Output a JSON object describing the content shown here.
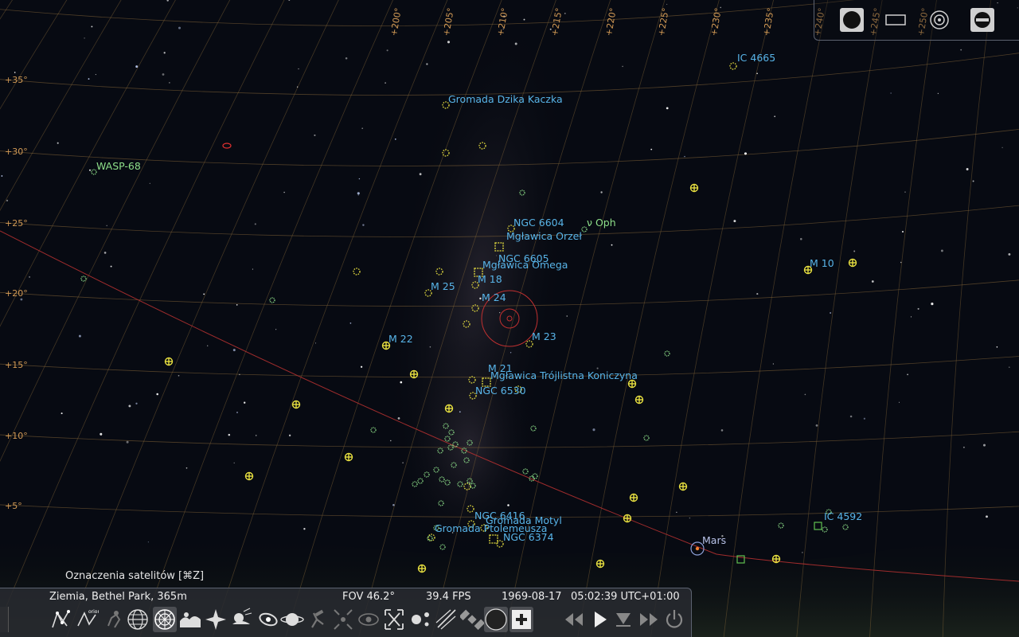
{
  "labels": {
    "dso": {
      "ic4665": "IC 4665",
      "duck": "Gromada Dzika Kaczka",
      "ngc6604": "NGC 6604",
      "eagle": "Mgławica Orzeł",
      "ngc6605": "NGC 6605",
      "omega": "Mgławica Omega",
      "m18": "M 18",
      "m25": "M 25",
      "m24": "M 24",
      "m10": "M 10",
      "m22": "M 22",
      "m23": "M 23",
      "m21": "M 21",
      "trifid": "Mgławica Trójlistna Koniczyna",
      "ngc6530": "NGC 6530",
      "ngc6416": "NGC 6416",
      "butterfly": "Gromada Motyl",
      "ptolemy": "Gromada Ptolemeusza",
      "ngc6374": "NGC 6374",
      "ic4592": "IC 4592"
    },
    "stars": {
      "wasp68": "WASP-68",
      "nu_oph": "ν Oph"
    },
    "planets": {
      "mars": "Mars"
    },
    "declination": [
      "+35°",
      "+30°",
      "+25°",
      "+20°",
      "+15°",
      "+10°",
      "+5°"
    ],
    "ra_top": [
      "+200°",
      "+205°",
      "+210°",
      "+215°",
      "+220°",
      "+225°",
      "+230°",
      "+235°",
      "+240°",
      "+245°",
      "+250°"
    ]
  },
  "colors": {
    "grid": "#8a6a3a",
    "ecliptic": "#b03030",
    "dso_label": "#58b4e8",
    "cluster_marker": "#e8e040",
    "star_marker": "#8ee08a"
  },
  "top_panel": {
    "buttons": [
      "fullscreen-icon",
      "window-icon",
      "settings-icon",
      "quit-icon"
    ]
  },
  "satellite_hint": "Oznaczenia satelitów  [⌘Z]",
  "status": {
    "location": "Ziemia, Bethel Park, 365m",
    "fov": "FOV 46.2°",
    "fps": "39.4 FPS",
    "date": "1969-08-17",
    "time": "05:02:39 UTC+01:00"
  },
  "toolbar": {
    "buttons": [
      {
        "name": "constellation-lines-icon",
        "active": false
      },
      {
        "name": "constellation-labels-icon",
        "active": false
      },
      {
        "name": "constellation-art-icon",
        "active": false
      },
      {
        "name": "equatorial-grid-icon",
        "active": false
      },
      {
        "name": "azimuthal-grid-icon",
        "active": true
      },
      {
        "name": "ground-icon",
        "active": false
      },
      {
        "name": "cardinal-points-icon",
        "active": false
      },
      {
        "name": "atmosphere-icon",
        "active": false
      },
      {
        "name": "nebulae-icon",
        "active": false
      },
      {
        "name": "planet-labels-icon",
        "active": false
      },
      {
        "name": "equatorial-mount-icon",
        "active": false
      },
      {
        "name": "center-object-icon",
        "active": false
      },
      {
        "name": "night-mode-icon",
        "active": false
      },
      {
        "name": "fullscreen-toggle-icon",
        "active": false
      },
      {
        "name": "exoplanets-icon",
        "active": false
      },
      {
        "name": "meteor-showers-icon",
        "active": false
      },
      {
        "name": "satellites-icon",
        "active": false
      },
      {
        "name": "ocular-icon",
        "active": true
      },
      {
        "name": "telescope-icon",
        "active": true
      },
      {
        "name": "rewind-icon",
        "active": false
      },
      {
        "name": "play-icon",
        "active": false
      },
      {
        "name": "real-time-icon",
        "active": false
      },
      {
        "name": "fast-forward-icon",
        "active": false
      },
      {
        "name": "quit-icon",
        "active": false
      }
    ]
  }
}
